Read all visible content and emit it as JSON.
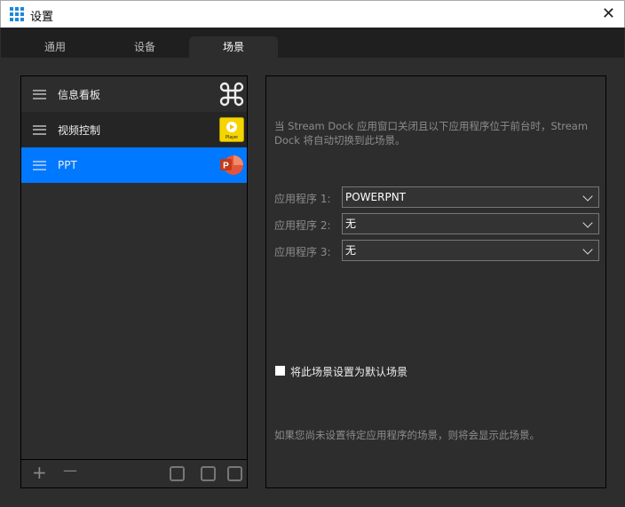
{
  "window": {
    "title": "设置",
    "close": "✕"
  },
  "tabs": [
    {
      "label": "通用"
    },
    {
      "label": "设备"
    },
    {
      "label": "场景"
    }
  ],
  "scenes": [
    {
      "label": "信息看板",
      "icon": "command-icon"
    },
    {
      "label": "视频控制",
      "icon": "player-icon",
      "badge": "Player"
    },
    {
      "label": "PPT",
      "icon": "powerpoint-icon",
      "badge": "P"
    }
  ],
  "footer": {
    "add": "+",
    "remove": "—"
  },
  "settings": {
    "description": "当 Stream Dock 应用窗口关闭且以下应用程序位于前台时，Stream Dock 将自动切换到此场景。",
    "apps": [
      {
        "label": "应用程序 1:",
        "value": "POWERPNT"
      },
      {
        "label": "应用程序 2:",
        "value": "无"
      },
      {
        "label": "应用程序 3:",
        "value": "无"
      }
    ],
    "default_label": "将此场景设置为默认场景",
    "note": "如果您尚未设置待定应用程序的场景，则将会显示此场景。"
  },
  "colors": {
    "selected": "#0078ff",
    "background": "#2d2d2d"
  }
}
